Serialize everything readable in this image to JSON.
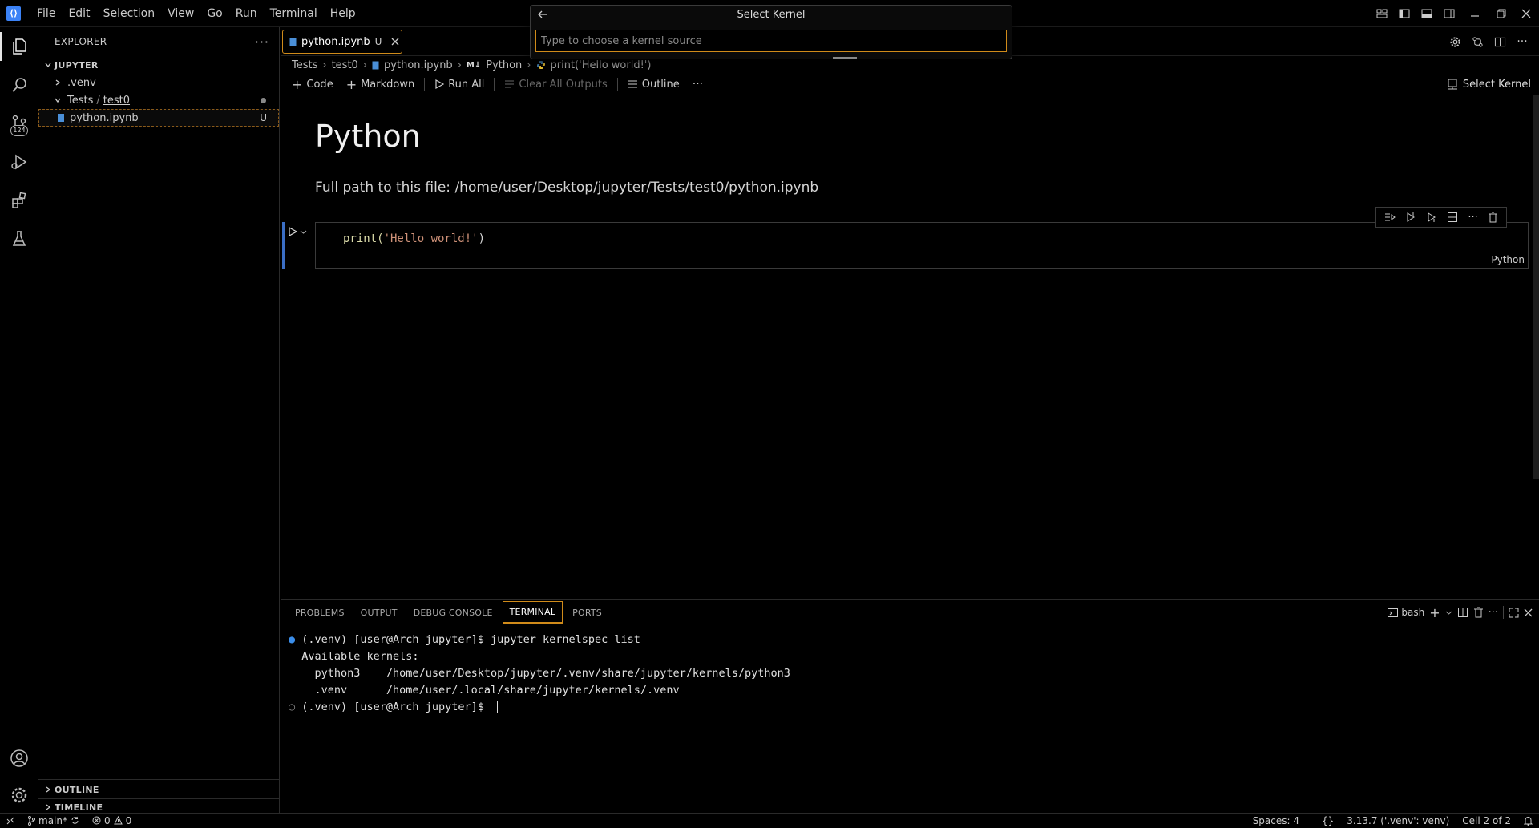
{
  "menu": [
    "File",
    "Edit",
    "Selection",
    "View",
    "Go",
    "Run",
    "Terminal",
    "Help"
  ],
  "sidebar": {
    "title": "EXPLORER",
    "root": "JUPYTER",
    "items": [
      {
        "label": ".venv"
      },
      {
        "label_parent": "Tests",
        "label_child": "test0"
      },
      {
        "label": "python.ipynb",
        "status": "U"
      }
    ],
    "outline": "OUTLINE",
    "timeline": "TIMELINE"
  },
  "activity": {
    "scm_badge": "124"
  },
  "tab": {
    "label": "python.ipynb",
    "status": "U"
  },
  "breadcrumb": {
    "c1": "Tests",
    "c2": "test0",
    "c3": "python.ipynb",
    "c4": "Python",
    "c5": "print('Hello world!')",
    "md_prefix": "M↓"
  },
  "toolbar": {
    "code": "Code",
    "markdown": "Markdown",
    "run_all": "Run All",
    "clear_outputs": "Clear All Outputs",
    "outline": "Outline",
    "select_kernel": "Select Kernel"
  },
  "notebook": {
    "md_title": "Python",
    "md_path": "Full path to this file: /home/user/Desktop/jupyter/Tests/test0/python.ipynb",
    "code_func": "print(",
    "code_str": "'Hello world!'",
    "code_end": ")",
    "cell_lang": "Python"
  },
  "quickpick": {
    "title": "Select Kernel",
    "placeholder": "Type to choose a kernel source"
  },
  "panel": {
    "tabs": [
      "PROBLEMS",
      "OUTPUT",
      "DEBUG CONSOLE",
      "TERMINAL",
      "PORTS"
    ],
    "shell": "bash",
    "terminal": {
      "l1": "(.venv) [user@Arch jupyter]$ jupyter kernelspec list",
      "l2": "Available kernels:",
      "l3": "  python3    /home/user/Desktop/jupyter/.venv/share/jupyter/kernels/python3",
      "l4": "  .venv      /home/user/.local/share/jupyter/kernels/.venv",
      "l5": "(.venv) [user@Arch jupyter]$ "
    }
  },
  "statusbar": {
    "branch": "main*",
    "errors": "0",
    "warnings": "0",
    "spaces": "Spaces: 4",
    "braces": "{}",
    "interpreter": "3.13.7 ('.venv': venv)",
    "cell": "Cell 2 of 2"
  },
  "colors": {
    "accent": "#d08b1a",
    "focus": "#3b6ec5",
    "string": "#ce9178"
  }
}
